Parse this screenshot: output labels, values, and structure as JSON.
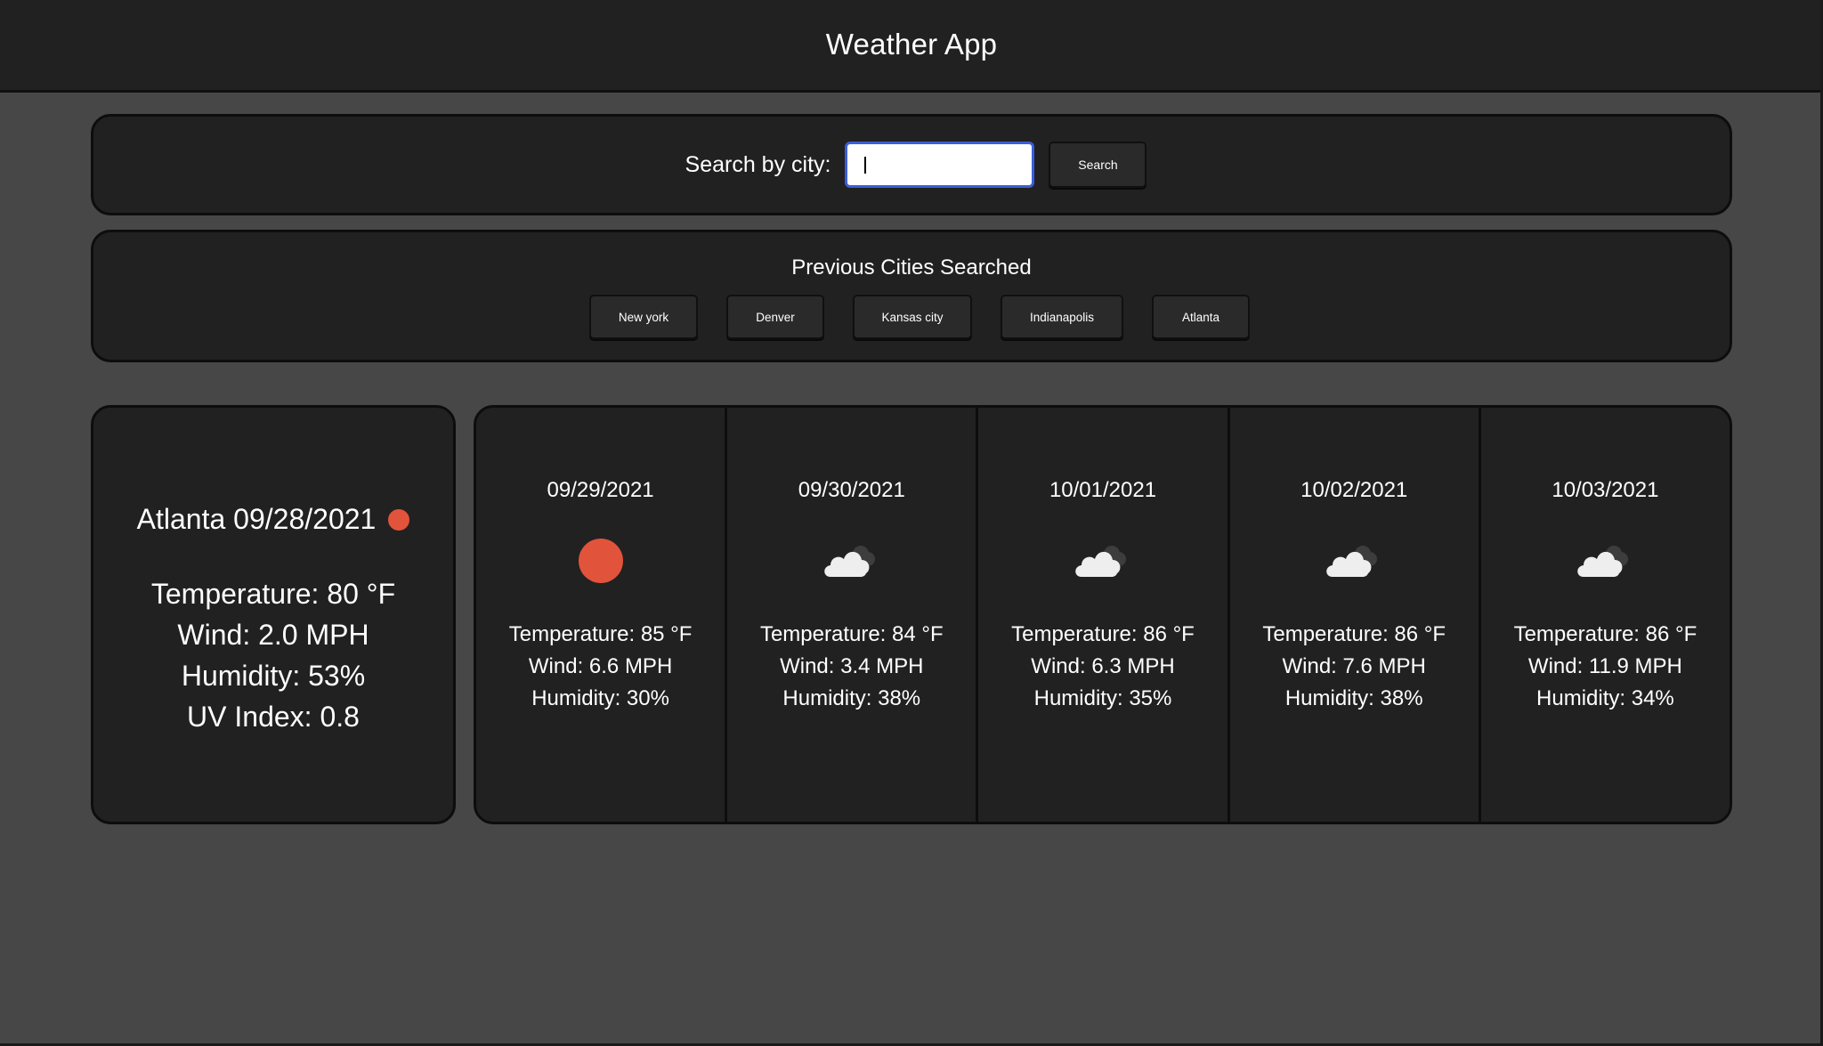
{
  "header": {
    "title": "Weather App"
  },
  "search": {
    "label": "Search by city:",
    "value": "",
    "placeholder": "",
    "button_label": "Search"
  },
  "history": {
    "title": "Previous Cities Searched",
    "cities": [
      "New york",
      "Denver",
      "Kansas city",
      "Indianapolis",
      "Atlanta"
    ]
  },
  "current": {
    "heading": "Atlanta 09/28/2021",
    "icon": "sun-icon",
    "icon_color": "#e2533b",
    "temperature": "Temperature: 80 °F",
    "wind": "Wind: 2.0 MPH",
    "humidity": "Humidity: 53%",
    "uv": "UV Index: 0.8"
  },
  "forecast": [
    {
      "date": "09/29/2021",
      "icon": "sun-icon",
      "temperature": "Temperature: 85 °F",
      "wind": "Wind: 6.6 MPH",
      "humidity": "Humidity: 30%"
    },
    {
      "date": "09/30/2021",
      "icon": "cloud-icon",
      "temperature": "Temperature: 84 °F",
      "wind": "Wind: 3.4 MPH",
      "humidity": "Humidity: 38%"
    },
    {
      "date": "10/01/2021",
      "icon": "cloud-icon",
      "temperature": "Temperature: 86 °F",
      "wind": "Wind: 6.3 MPH",
      "humidity": "Humidity: 35%"
    },
    {
      "date": "10/02/2021",
      "icon": "cloud-icon",
      "temperature": "Temperature: 86 °F",
      "wind": "Wind: 7.6 MPH",
      "humidity": "Humidity: 38%"
    },
    {
      "date": "10/03/2021",
      "icon": "cloud-icon",
      "temperature": "Temperature: 86 °F",
      "wind": "Wind: 11.9 MPH",
      "humidity": "Humidity: 34%"
    }
  ],
  "colors": {
    "background": "#474747",
    "panel": "#212121",
    "sun": "#e2533b",
    "input_focus": "#3a5fd9"
  }
}
